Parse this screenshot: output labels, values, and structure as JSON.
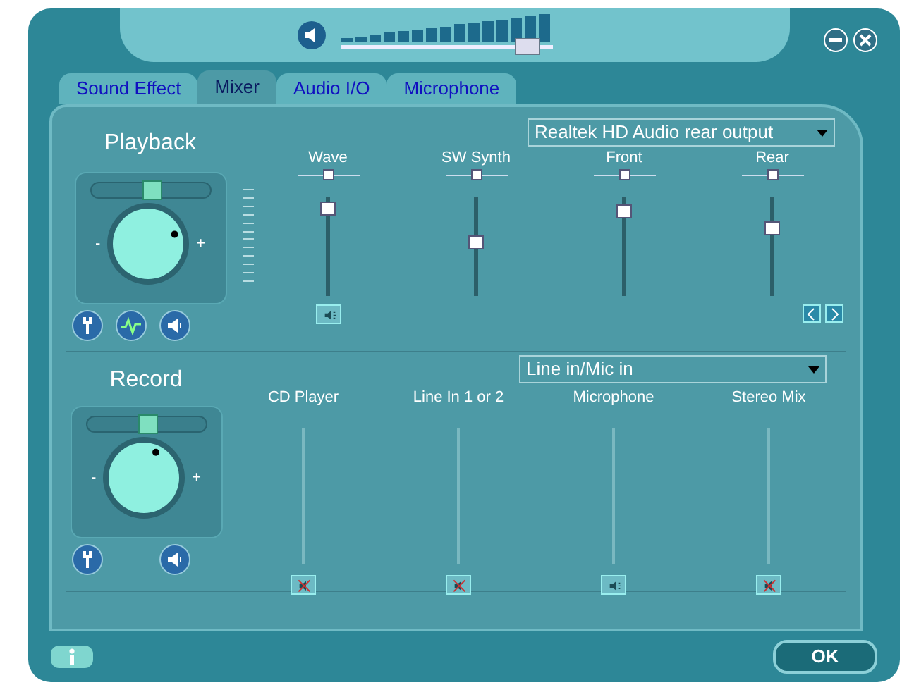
{
  "master_volume": {
    "level": 0.93,
    "muted": false
  },
  "tabs": [
    {
      "label": "Sound Effect",
      "selected": false
    },
    {
      "label": "Mixer",
      "selected": true
    },
    {
      "label": "Audio I/O",
      "selected": false
    },
    {
      "label": "Microphone",
      "selected": false
    }
  ],
  "playback": {
    "title": "Playback",
    "balance": {
      "level": 0.5
    },
    "knob": {
      "minus_label": "-",
      "plus_label": "+"
    },
    "device": "Realtek HD Audio rear output",
    "channels": [
      {
        "name": "Wave",
        "balance": {
          "level": 0.5
        },
        "level": 0.95,
        "muted": false
      },
      {
        "name": "SW Synth",
        "balance": {
          "level": 0.5
        },
        "level": 0.55
      },
      {
        "name": "Front",
        "balance": {
          "level": 0.5
        },
        "level": 0.92
      },
      {
        "name": "Rear",
        "balance": {
          "level": 0.5
        },
        "level": 0.72
      }
    ]
  },
  "record": {
    "title": "Record",
    "balance": {
      "level": 0.5
    },
    "knob": {
      "minus_label": "-",
      "plus_label": "+"
    },
    "source": "Line in/Mic in",
    "channels": [
      {
        "name": "CD Player",
        "muted": true
      },
      {
        "name": "Line In 1 or 2",
        "muted": true
      },
      {
        "name": "Microphone",
        "muted": false
      },
      {
        "name": "Stereo Mix",
        "muted": true
      }
    ]
  },
  "ok_button": "OK"
}
